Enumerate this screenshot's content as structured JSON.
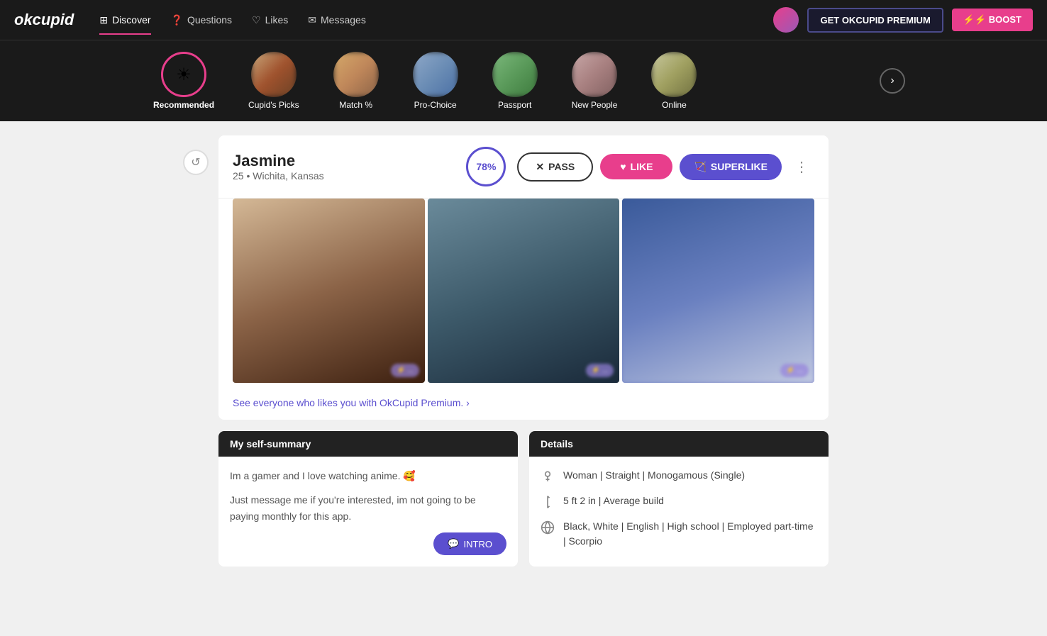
{
  "app": {
    "logo": "okcupid",
    "premium_btn": "GET OKCUPID PREMIUM",
    "boost_btn": "⚡ BOOST"
  },
  "nav": {
    "items": [
      {
        "id": "discover",
        "label": "Discover",
        "active": true,
        "icon": "⊞"
      },
      {
        "id": "questions",
        "label": "Questions",
        "active": false,
        "icon": "?"
      },
      {
        "id": "likes",
        "label": "Likes",
        "active": false,
        "icon": "♡"
      },
      {
        "id": "messages",
        "label": "Messages",
        "active": false,
        "icon": "✉"
      }
    ]
  },
  "categories": [
    {
      "id": "recommended",
      "label": "Recommended",
      "active": true,
      "type": "icon"
    },
    {
      "id": "cupids-picks",
      "label": "Cupid's Picks",
      "active": false,
      "type": "img",
      "imgClass": "img1"
    },
    {
      "id": "match",
      "label": "Match %",
      "active": false,
      "type": "img",
      "imgClass": "img2"
    },
    {
      "id": "pro-choice",
      "label": "Pro-Choice",
      "active": false,
      "type": "img",
      "imgClass": "img3"
    },
    {
      "id": "passport",
      "label": "Passport",
      "active": false,
      "type": "img",
      "imgClass": "img4"
    },
    {
      "id": "new-people",
      "label": "New People",
      "active": false,
      "type": "img",
      "imgClass": "img5"
    },
    {
      "id": "online",
      "label": "Online",
      "active": false,
      "type": "img",
      "imgClass": "img6"
    }
  ],
  "profile": {
    "name": "Jasmine",
    "age": "25",
    "location": "Wichita, Kansas",
    "match_pct": "78%",
    "pass_label": "PASS",
    "like_label": "LIKE",
    "superlike_label": "SUPERLIKE",
    "premium_link": "See everyone who likes you with OkCupid Premium. ›",
    "self_summary_header": "My self-summary",
    "self_summary_line1": "Im a gamer and I love watching anime. 🥰",
    "self_summary_line2": "Just message me if you're interested, im not going to be paying monthly for this app.",
    "intro_btn": "INTRO",
    "details_header": "Details",
    "details": [
      {
        "icon": "person",
        "text": "Woman | Straight | Monogamous (Single)"
      },
      {
        "icon": "height",
        "text": "5 ft 2 in | Average build"
      },
      {
        "icon": "globe",
        "text": "Black, White | English | High school | Employed part-time | Scorpio"
      }
    ]
  }
}
